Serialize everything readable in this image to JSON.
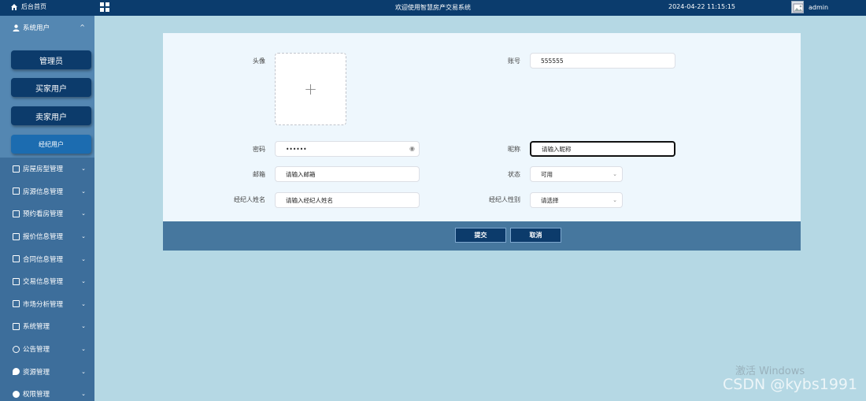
{
  "topbar": {
    "home_label": "后台首页",
    "title": "欢迎使用智慧房产交易系统",
    "datetime": "2024-04-22 11:15:15",
    "username": "admin"
  },
  "sidebar": {
    "open_group": {
      "label": "系统用户",
      "icon": "user-icon"
    },
    "sub_items": [
      {
        "label": "管理员"
      },
      {
        "label": "买家用户"
      },
      {
        "label": "卖家用户"
      },
      {
        "label": "经纪用户",
        "active": true
      }
    ],
    "items": [
      {
        "label": "房屋房型管理"
      },
      {
        "label": "房源信息管理"
      },
      {
        "label": "预约看房管理"
      },
      {
        "label": "报价信息管理"
      },
      {
        "label": "合同信息管理"
      },
      {
        "label": "交易信息管理"
      },
      {
        "label": "市场分析管理"
      },
      {
        "label": "系统管理"
      },
      {
        "label": "公告管理"
      },
      {
        "label": "资源管理"
      },
      {
        "label": "权限管理"
      }
    ]
  },
  "form": {
    "avatar_label": "头像",
    "account_label": "账号",
    "account_value": "555555",
    "password_label": "密码",
    "password_value": "••••••",
    "nickname_label": "昵称",
    "nickname_placeholder": "请输入昵称",
    "email_label": "邮箱",
    "email_placeholder": "请输入邮箱",
    "status_label": "状态",
    "status_value": "可用",
    "agent_name_label": "经纪人姓名",
    "agent_name_placeholder": "请输入经纪人姓名",
    "agent_gender_label": "经纪人性别",
    "agent_gender_placeholder": "请选择"
  },
  "actions": {
    "submit_label": "提交",
    "cancel_label": "取消"
  },
  "watermark": {
    "windows": "激活 Windows",
    "csdn": "CSDN @kybs1991"
  }
}
